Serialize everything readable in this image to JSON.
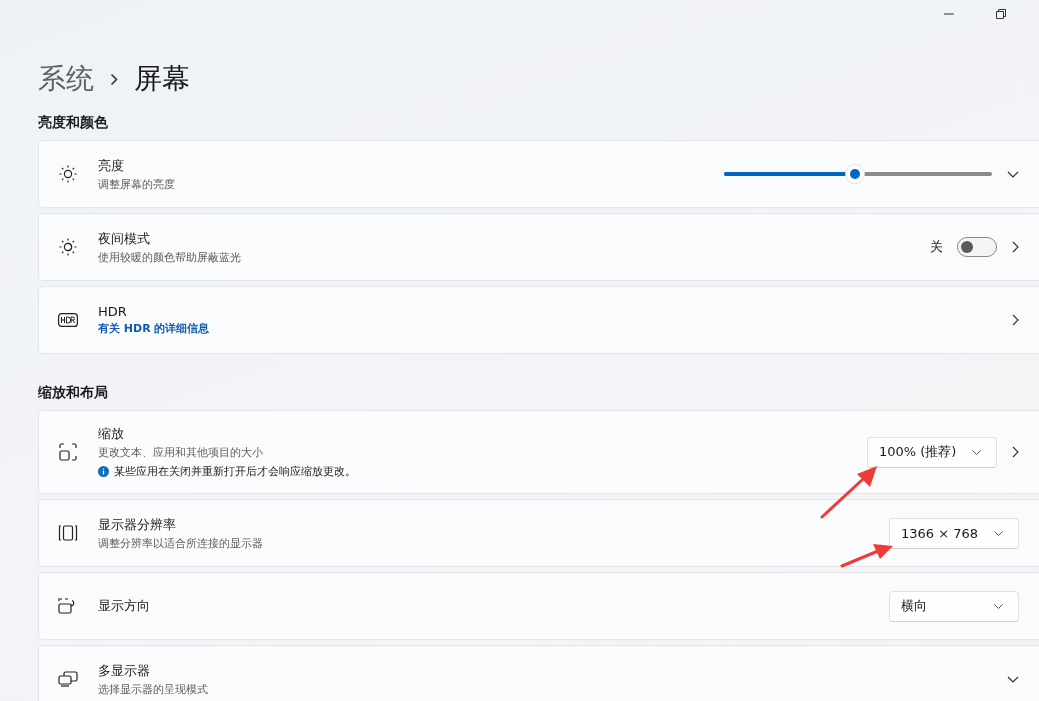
{
  "breadcrumb": {
    "parent": "系统",
    "current": "屏幕"
  },
  "sections": [
    {
      "heading": "亮度和颜色",
      "rows": [
        {
          "kind": "slider",
          "title": "亮度",
          "subtitle": "调整屏幕的亮度",
          "level": 0.49,
          "opens_page": false,
          "expandable": true
        },
        {
          "kind": "toggle",
          "title": "夜间模式",
          "subtitle": "使用较暖的颜色帮助屏蔽蓝光",
          "state_label": "关",
          "on": false,
          "opens_page": true,
          "expandable": false
        },
        {
          "kind": "link",
          "title": "HDR",
          "link": "有关 HDR 的详细信息",
          "opens_page": true,
          "expandable": false
        }
      ]
    },
    {
      "heading": "缩放和布局",
      "rows": [
        {
          "kind": "dropdown",
          "title": "缩放",
          "subtitle": "更改文本、应用和其他项目的大小",
          "note": "某些应用在关闭并重新打开后才会响应缩放更改。",
          "value": "100% (推荐)",
          "opens_page": true,
          "expandable": false
        },
        {
          "kind": "dropdown",
          "title": "显示器分辨率",
          "subtitle": "调整分辨率以适合所连接的显示器",
          "value": "1366 × 768",
          "opens_page": false,
          "expandable": false
        },
        {
          "kind": "dropdown",
          "title": "显示方向",
          "value": "横向",
          "opens_page": false,
          "expandable": false
        },
        {
          "kind": "plain",
          "title": "多显示器",
          "subtitle": "选择显示器的呈现模式",
          "opens_page": false,
          "expandable": true
        }
      ]
    }
  ]
}
